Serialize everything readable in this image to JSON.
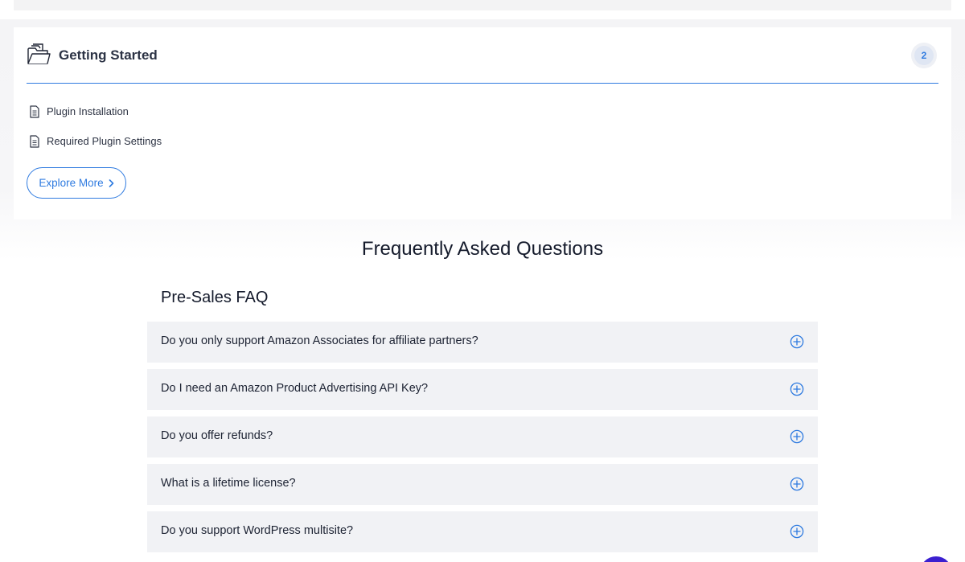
{
  "card": {
    "title": "Getting Started",
    "count": "2",
    "items": [
      {
        "label": "Plugin Installation"
      },
      {
        "label": "Required Plugin Settings"
      }
    ],
    "explore_label": "Explore More"
  },
  "faq": {
    "title": "Frequently Asked Questions",
    "subtitle": "Pre-Sales FAQ",
    "questions": [
      {
        "text": "Do you only support Amazon Associates for affiliate partners?"
      },
      {
        "text": "Do I need an Amazon Product Advertising API Key?"
      },
      {
        "text": "Do you offer refunds?"
      },
      {
        "text": "What is a lifetime license?"
      },
      {
        "text": "Do you support WordPress multisite?"
      }
    ]
  },
  "icons": {
    "section": "folder-icon",
    "item": "document-icon",
    "expand": "plus-circle-icon",
    "button": "chevron-right-icon",
    "chat": "chat-bubble-icon"
  },
  "colors": {
    "accent": "#2f7be0",
    "faq_row_bg": "#f1f2f5",
    "chat": "#3b1fd0"
  }
}
